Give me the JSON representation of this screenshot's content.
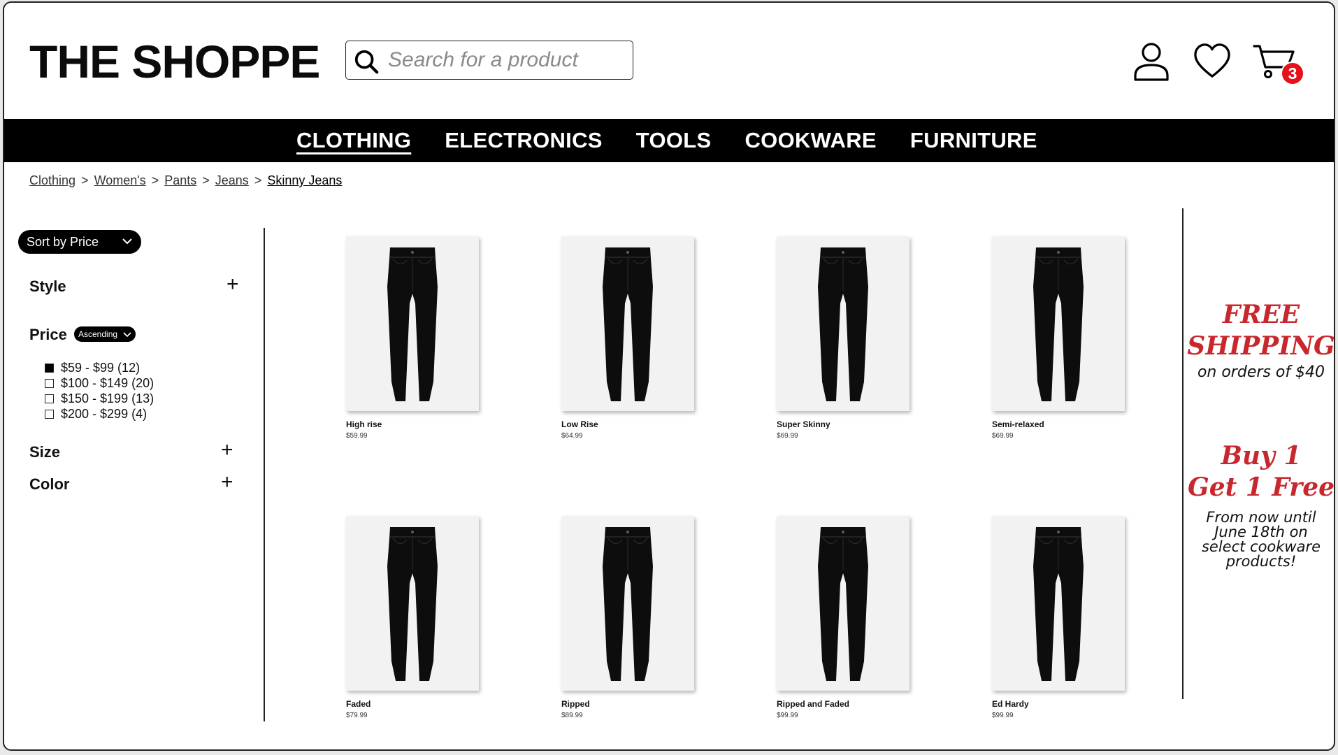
{
  "header": {
    "logo": "THE SHOPPE",
    "search_placeholder": "Search for a product",
    "cart_count": "3",
    "icons": [
      "search-icon",
      "user-icon",
      "heart-icon",
      "cart-icon"
    ]
  },
  "nav": {
    "items": [
      {
        "label": "CLOTHING",
        "active": true
      },
      {
        "label": "ELECTRONICS",
        "active": false
      },
      {
        "label": "TOOLS",
        "active": false
      },
      {
        "label": "COOKWARE",
        "active": false
      },
      {
        "label": "FURNITURE",
        "active": false
      }
    ]
  },
  "breadcrumb": {
    "items": [
      "Clothing",
      "Women's",
      "Pants",
      "Jeans",
      "Skinny Jeans"
    ],
    "separator": ">"
  },
  "sidebar": {
    "sort_label": "Sort by Price",
    "style_label": "Style",
    "price_label": "Price",
    "price_order": "Ascending",
    "price_options": [
      {
        "label": "$59 - $99 (12)",
        "checked": true
      },
      {
        "label": "$100 - $149 (20)",
        "checked": false
      },
      {
        "label": "$150 - $199 (13)",
        "checked": false
      },
      {
        "label": "$200 - $299 (4)",
        "checked": false
      }
    ],
    "size_label": "Size",
    "color_label": "Color",
    "expand_symbol": "+"
  },
  "products": [
    {
      "name": "High rise",
      "price": "$59.99"
    },
    {
      "name": "Low Rise",
      "price": "$64.99"
    },
    {
      "name": "Super Skinny",
      "price": "$69.99"
    },
    {
      "name": "Semi-relaxed",
      "price": "$69.99"
    },
    {
      "name": "Faded",
      "price": "$79.99"
    },
    {
      "name": "Ripped",
      "price": "$89.99"
    },
    {
      "name": "Ripped and Faded",
      "price": "$99.99"
    },
    {
      "name": "Ed Hardy",
      "price": "$99.99"
    }
  ],
  "promos": {
    "shipping_line1": "FREE",
    "shipping_line2": "SHIPPING",
    "shipping_sub": "on orders of $40",
    "bogo_line1": "Buy 1",
    "bogo_line2": "Get 1 Free",
    "bogo_sub": "From now until June 18th on select cookware products!"
  },
  "colors": {
    "accent_red": "#c8272d",
    "badge_red": "#e8101a",
    "nav_bg": "#000000"
  }
}
